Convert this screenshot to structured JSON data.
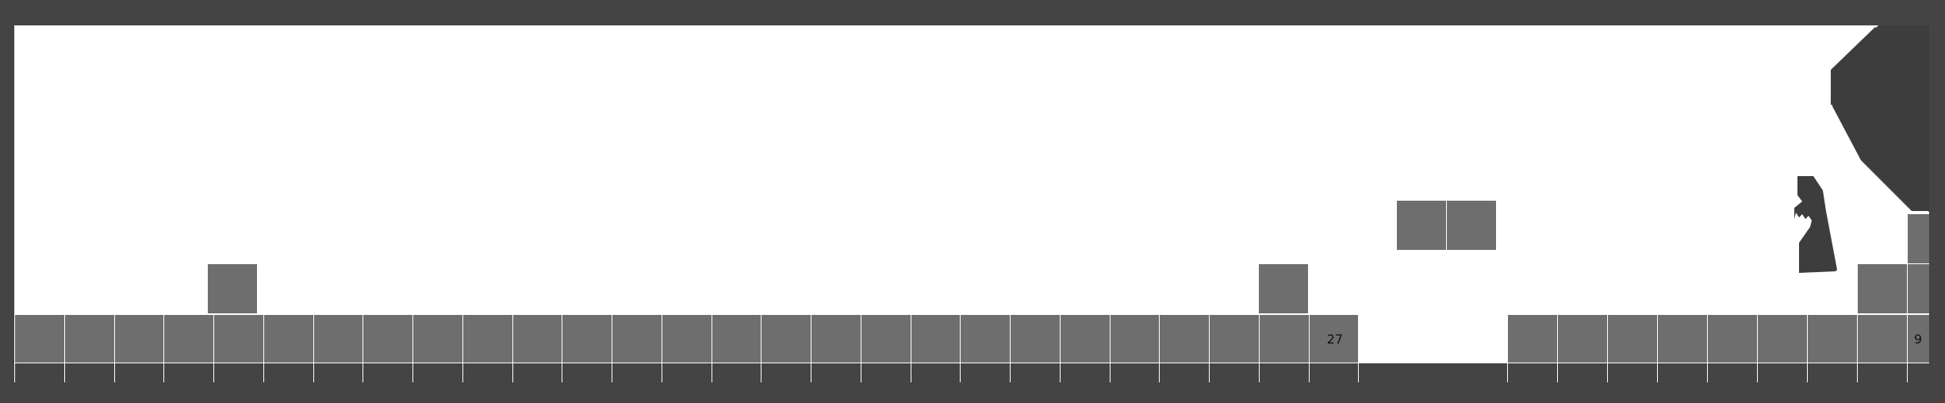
{
  "game": {
    "colors": {
      "frame": "#444444",
      "sky": "#ffffff",
      "block": "#6e6e6e",
      "silhouette": "#3d3d3d"
    },
    "tile_labels": {
      "ground_27": "27",
      "ground_9": "9"
    },
    "sprites": {
      "player": "cloaked-figure-silhouette",
      "tree": "tree-canopy-silhouette",
      "hazard": "spike-icon"
    }
  }
}
